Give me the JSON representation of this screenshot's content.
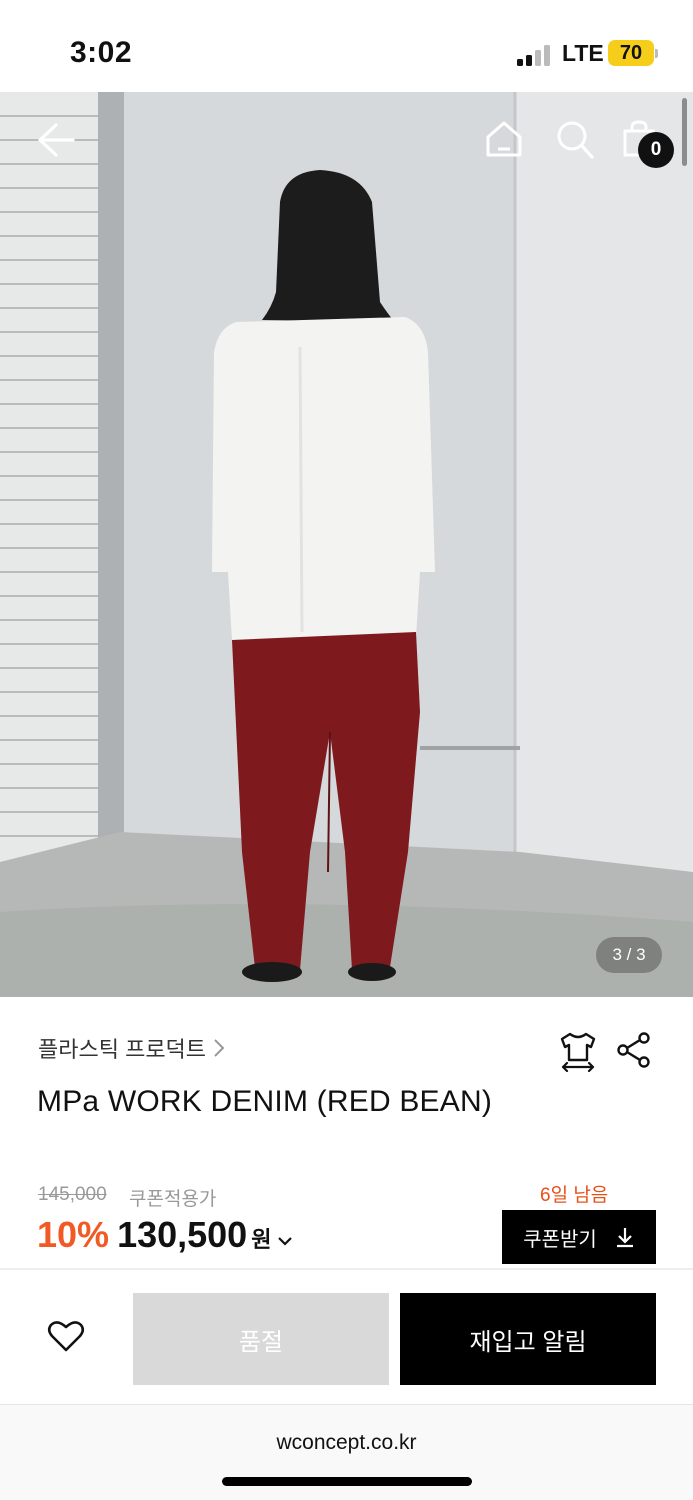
{
  "status_bar": {
    "time": "3:02",
    "network": "LTE",
    "battery": "70"
  },
  "hero": {
    "cart_count": "0",
    "page_indicator": "3 / 3",
    "icons": [
      "back-arrow-icon",
      "home-icon",
      "search-icon",
      "shopping-bag-icon"
    ]
  },
  "product": {
    "brand": "플라스틱 프로덕트",
    "title": "MPa WORK DENIM (RED BEAN)",
    "original_price": "145,000",
    "coupon_note": "쿠폰적용가",
    "days_left": "6일 남음",
    "discount": "10%",
    "price": "130,500",
    "currency": "원",
    "coupon_button": "쿠폰받기"
  },
  "actions": {
    "soldout": "품절",
    "restock_alert": "재입고 알림"
  },
  "browser": {
    "url": "wconcept.co.kr"
  },
  "colors": {
    "accent": "#f15a24",
    "days_left": "#e8501a",
    "pants": "#7e1a1d"
  }
}
